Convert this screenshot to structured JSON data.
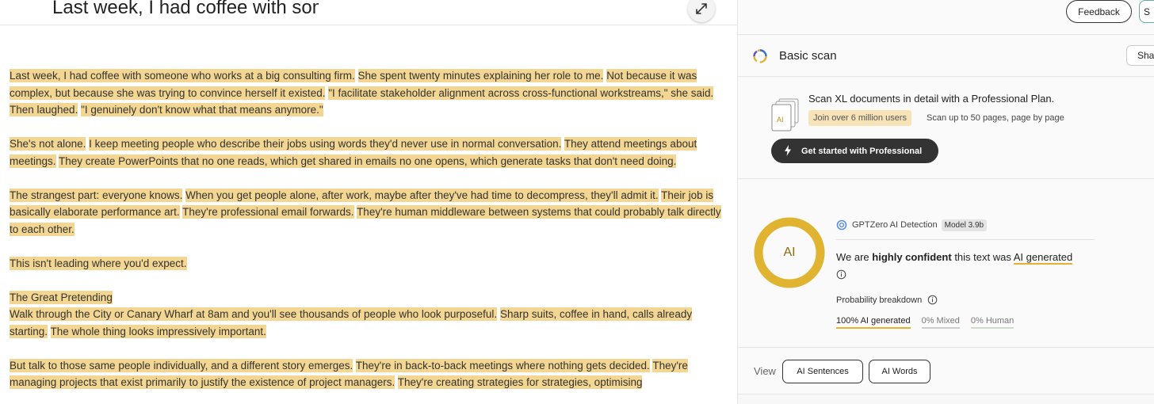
{
  "doc": {
    "title": "Last week, I had coffee with som",
    "paragraphs": [
      [
        "Last week, I had coffee with someone who works at a big consulting firm.",
        "She spent twenty minutes explaining her role to me.",
        "Not because it was complex, but because she was trying to convince herself it existed.",
        "\"I facilitate stakeholder alignment across cross-functional workstreams,\" she said.",
        "Then laughed.",
        "\"I genuinely don't know what that means anymore.\""
      ],
      [
        "She's not alone.",
        "I keep meeting people who describe their jobs using words they'd never use in normal conversation.",
        "They attend meetings about meetings.",
        "They create PowerPoints that no one reads, which get shared in emails no one opens, which generate tasks that don't need doing."
      ],
      [
        "The strangest part: everyone knows.",
        "When you get people alone, after work, maybe after they've had time to decompress, they'll admit it.",
        "Their job is basically elaborate performance art.",
        "They're professional email forwards.",
        "They're human middleware between systems that could probably talk directly to each other."
      ],
      [
        "This isn't leading where you'd expect."
      ],
      [
        "The Great Pretending",
        "Walk through the City or Canary Wharf at 8am and you'll see thousands of people who look purposeful.",
        "Sharp suits, coffee in hand, calls already starting.",
        "The whole thing looks impressively important."
      ],
      [
        "But talk to those same people individually, and a different story emerges.",
        "They're in back-to-back meetings where nothing gets decided.",
        "They're managing projects that exist primarily to justify the existence of project managers.",
        "They're creating strategies for strategies, optimising"
      ]
    ]
  },
  "topbar": {
    "feedback_label": "Feedback",
    "edge_label": "S"
  },
  "scan": {
    "title": "Basic scan",
    "share_label": "Sha"
  },
  "promo": {
    "title": "Scan XL documents in detail with a Professional Plan.",
    "badge": "Join over 6 million users",
    "scan_up": "Scan up to 50 pages, page by page",
    "cta_label": "Get started with Professional",
    "doc_icon_text": "AI"
  },
  "result": {
    "ring_label": "AI",
    "ai_probability": 1.0,
    "detector_name": "GPTZero AI Detection",
    "model": "Model 3.9b",
    "verdict_prefix": "We are",
    "verdict_confidence": "highly confident",
    "verdict_middle": "this text was",
    "verdict_label": "AI generated",
    "prob_title": "Probability breakdown",
    "prob_ai": "100% AI generated",
    "prob_mixed": "0% Mixed",
    "prob_human": "0% Human"
  },
  "view": {
    "label": "View",
    "btn_sentences": "AI Sentences",
    "btn_words": "AI Words"
  },
  "colors": {
    "highlight": "#f3d691",
    "accent": "#e0b430",
    "dark_button": "#333333"
  }
}
